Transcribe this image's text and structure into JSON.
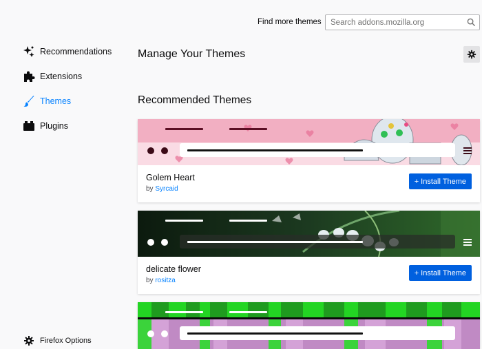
{
  "header": {
    "find_label": "Find more themes",
    "search_placeholder": "Search addons.mozilla.org"
  },
  "sidebar": {
    "items": [
      {
        "label": "Recommendations",
        "icon": "recommendations-icon"
      },
      {
        "label": "Extensions",
        "icon": "puzzle-icon"
      },
      {
        "label": "Themes",
        "icon": "brush-icon",
        "active": true
      },
      {
        "label": "Plugins",
        "icon": "plugin-icon"
      }
    ],
    "options_label": "Firefox Options"
  },
  "main": {
    "title": "Manage Your Themes",
    "section_title": "Recommended Themes",
    "themes": [
      {
        "name": "Golem Heart",
        "by": "by",
        "author": "Syrcaid",
        "install_label": "+ Install Theme"
      },
      {
        "name": "delicate flower",
        "by": "by",
        "author": "rositza",
        "install_label": "+ Install Theme"
      },
      {
        "name": "",
        "by": "",
        "author": "",
        "install_label": ""
      }
    ]
  },
  "colors": {
    "accent": "#0a84ff",
    "install_button": "#0060df",
    "background": "#f9f9fa"
  }
}
